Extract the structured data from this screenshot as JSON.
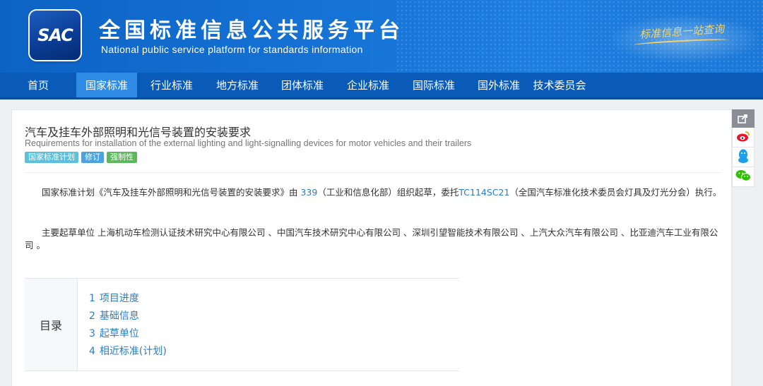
{
  "header": {
    "logo_text": "SAC",
    "title_cn": "全国标准信息公共服务平台",
    "title_en": "National public service platform  for standards information",
    "slogan": "标准信息一站查询"
  },
  "nav": {
    "items": [
      {
        "label": "首页"
      },
      {
        "label": "国家标准"
      },
      {
        "label": "行业标准"
      },
      {
        "label": "地方标准"
      },
      {
        "label": "团体标准"
      },
      {
        "label": "企业标准"
      },
      {
        "label": "国际标准"
      },
      {
        "label": "国外标准"
      },
      {
        "label": "技术委员会"
      }
    ],
    "active": "国家标准"
  },
  "standard": {
    "title_cn": "汽车及挂车外部照明和光信号装置的安装要求",
    "title_en": "Requirements for installation of the external lighting and light-signalling devices for motor vehicles and their trailers",
    "badges": [
      "国家标准计划",
      "修订",
      "强制性"
    ]
  },
  "description": {
    "p1_prefix": "国家标准计划《汽车及挂车外部照明和光信号装置的安装要求》由 ",
    "p1_org_code": "339",
    "p1_middle": "（工业和信息化部）组织起草，委托",
    "p1_tc": "TC114SC21",
    "p1_suffix": "（全国汽车标准化技术委员会灯具及灯光分会）执行。",
    "p2": "主要起草单位 上海机动车检测认证技术研究中心有限公司 、中国汽车技术研究中心有限公司 、深圳引望智能技术有限公司 、上汽大众汽车有限公司 、比亚迪汽车工业有限公司 。"
  },
  "toc": {
    "label": "目录",
    "items": [
      {
        "num": "1",
        "label": "项目进度"
      },
      {
        "num": "2",
        "label": "基础信息"
      },
      {
        "num": "3",
        "label": "起草单位"
      },
      {
        "num": "4",
        "label": "相近标准(计划)"
      }
    ]
  },
  "colors": {
    "brand_blue": "#0a5ab8",
    "nav_active": "#2f8ce6",
    "link": "#2a7dc9",
    "badge_plan": "#5bc0de",
    "badge_revision": "#4aa3df",
    "badge_mandatory": "#5cb85c"
  }
}
